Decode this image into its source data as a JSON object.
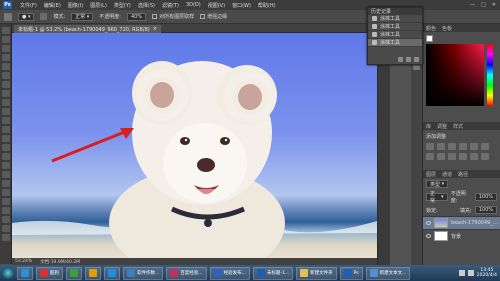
{
  "app": {
    "logo": "Ps"
  },
  "menu": [
    "文件(F)",
    "编辑(E)",
    "图像(I)",
    "图层(L)",
    "类型(Y)",
    "选择(S)",
    "滤镜(T)",
    "3D(D)",
    "视图(V)",
    "窗口(W)",
    "帮助(H)"
  ],
  "window_controls": [
    "—",
    "□",
    "✕"
  ],
  "options": {
    "mode_label": "模式:",
    "mode_value": "正常",
    "opacity_label": "不透明度:",
    "opacity_value": "40%",
    "sample_all_layers": "对所有图层取样",
    "enhance_edges": "增强边缘"
  },
  "document": {
    "tab_title": "未标题-1 @ 53.2% (beach-1790049_960_720, RGB/8)",
    "close": "×"
  },
  "status": {
    "zoom": "53.24%",
    "doc": "文档:19.9M/40.2M"
  },
  "history": {
    "title": "历史记录",
    "items": [
      {
        "label": "涂抹工具",
        "selected": false
      },
      {
        "label": "涂抹工具",
        "selected": false
      },
      {
        "label": "涂抹工具",
        "selected": false
      },
      {
        "label": "涂抹工具",
        "selected": true
      }
    ]
  },
  "right_panel": {
    "color_tabs": [
      "颜色",
      "色板"
    ],
    "adjust_tabs": [
      "库",
      "调整",
      "样式"
    ],
    "adjust_title": "添加调整",
    "layers_tabs": [
      "图层",
      "通道",
      "路径"
    ],
    "kind_label": "类型",
    "blend_mode": "正常",
    "opacity_label": "不透明度:",
    "opacity_value": "100%",
    "lock_label": "锁定:",
    "fill_label": "填充:",
    "fill_value": "100%",
    "layers": [
      {
        "name": "beach-1790049_960_720",
        "selected": true,
        "thumb": "photo"
      },
      {
        "name": "背景",
        "selected": false,
        "thumb": "white"
      }
    ]
  },
  "colors": {
    "accent": "#1e5fb3",
    "arrow": "#d62020",
    "sky": "#5f78e8"
  },
  "taskbar": {
    "items": [
      {
        "label": "",
        "color": "#2d8fd8"
      },
      {
        "label": "酷狗",
        "color": "#d83030"
      },
      {
        "label": "",
        "color": "#3aa03a"
      },
      {
        "label": "",
        "color": "#e0a000"
      },
      {
        "label": "",
        "color": "#1a8fe0"
      },
      {
        "label": "软件作数...",
        "color": "#3a80c0"
      },
      {
        "label": "百度经验...",
        "color": "#c03060"
      },
      {
        "label": "经验发布...",
        "color": "#3060c0"
      },
      {
        "label": "未标题-1...",
        "color": "#1e5fb3"
      },
      {
        "label": "新建文件夹",
        "color": "#e0c050"
      },
      {
        "label": "Ps",
        "color": "#1e5fb3"
      },
      {
        "label": "新建文本文...",
        "color": "#5090d0"
      }
    ],
    "time": "13:45",
    "date": "2020/4/4"
  }
}
